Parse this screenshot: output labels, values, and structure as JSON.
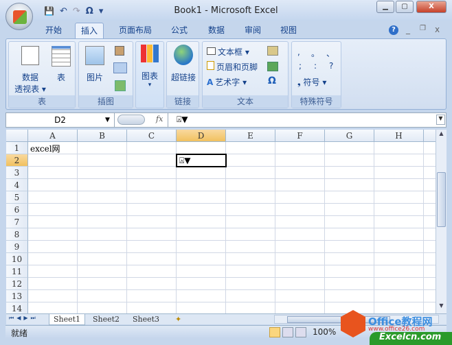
{
  "window": {
    "title": "Book1 - Microsoft Excel",
    "minimize": "▁",
    "maximize": "▢",
    "close": "X"
  },
  "qat": {
    "save": "💾",
    "undo": "↶",
    "redo": "↷",
    "omega": "Ω",
    "customize": "▾"
  },
  "tabs": [
    {
      "label": "开始"
    },
    {
      "label": "插入",
      "active": true
    },
    {
      "label": "页面布局"
    },
    {
      "label": "公式"
    },
    {
      "label": "数据"
    },
    {
      "label": "审阅"
    },
    {
      "label": "视图"
    }
  ],
  "help": "?",
  "ribbon": {
    "groups": {
      "table": "表",
      "illustrations": "插图",
      "charts": "",
      "links": "链接",
      "text": "文本",
      "special": "特殊符号"
    },
    "pivot": "数据",
    "pivot2": "透视表 ▾",
    "table": "表",
    "picture": "图片",
    "chart": "图表",
    "chart_arrow": "▾",
    "hyperlink": "超链接",
    "textbox": "文本框 ▾",
    "headerfooter": "页眉和页脚",
    "wordart": "艺术字 ▾",
    "omega": "Ω",
    "symbols": [
      ",",
      "。",
      "、",
      ";",
      ":",
      "?"
    ],
    "symbol_btn": "符号 ▾",
    "symbol_glyph": "❟"
  },
  "formula_bar": {
    "name_box": "D2",
    "fx": "fx",
    "content": "⍓▼"
  },
  "columns": [
    "A",
    "B",
    "C",
    "D",
    "E",
    "F",
    "G",
    "H"
  ],
  "rows": [
    "1",
    "2",
    "3",
    "4",
    "5",
    "6",
    "7",
    "8",
    "9",
    "10",
    "11",
    "12",
    "13",
    "14"
  ],
  "cells": {
    "A1": "excel网",
    "D2": "⍓▼"
  },
  "sheets": [
    "Sheet1",
    "Sheet2",
    "Sheet3"
  ],
  "status": {
    "ready": "就绪",
    "zoom": "100%"
  },
  "watermark": {
    "brand": "Office教程网",
    "url": "www.office26.com",
    "site": "Excelcn.com"
  }
}
